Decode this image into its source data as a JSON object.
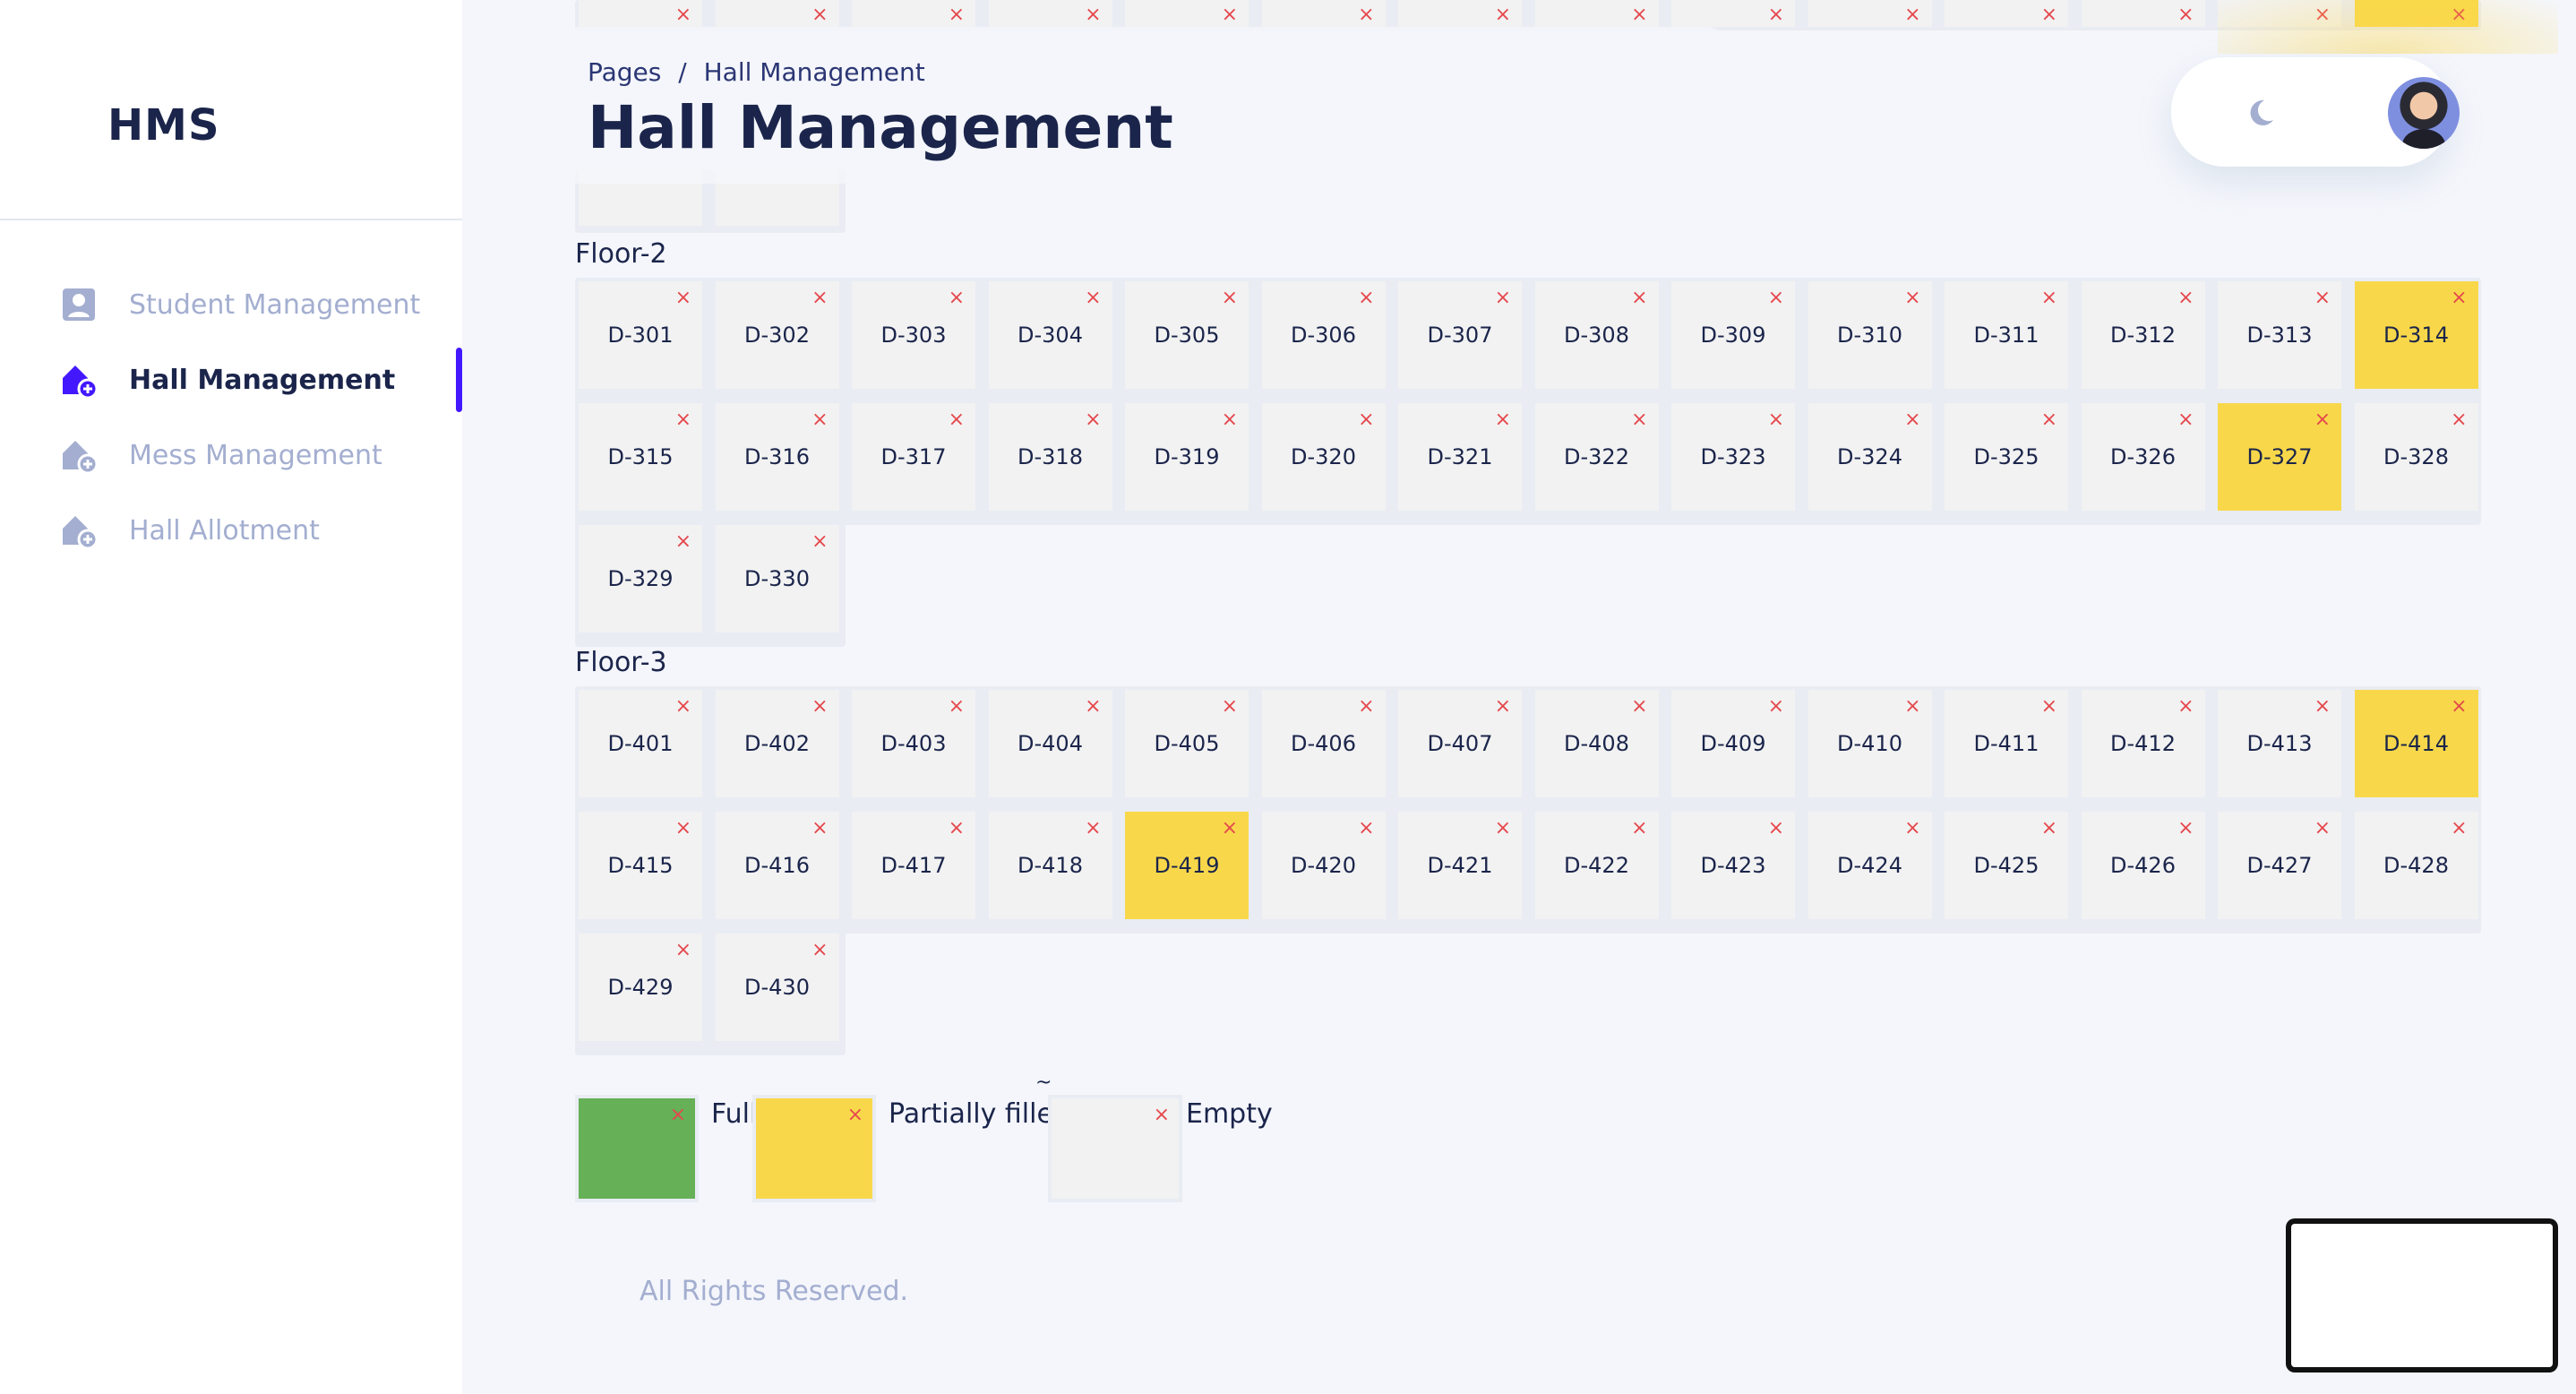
{
  "sidebar": {
    "logo": "HMS",
    "items": [
      {
        "label": "Student Management",
        "icon": "user-square-icon",
        "active": false
      },
      {
        "label": "Hall Management",
        "icon": "home-add-icon",
        "active": true
      },
      {
        "label": "Mess Management",
        "icon": "home-add-icon",
        "active": false
      },
      {
        "label": "Hall Allotment",
        "icon": "home-add-icon",
        "active": false
      }
    ]
  },
  "header": {
    "breadcrumb_root": "Pages",
    "breadcrumb_sep": "/",
    "breadcrumb_current": "Hall Management",
    "title": "Hall Management"
  },
  "floors": [
    {
      "label": "Floor-2",
      "rooms": [
        {
          "id": "D-301",
          "status": "empty"
        },
        {
          "id": "D-302",
          "status": "empty"
        },
        {
          "id": "D-303",
          "status": "empty"
        },
        {
          "id": "D-304",
          "status": "empty"
        },
        {
          "id": "D-305",
          "status": "empty"
        },
        {
          "id": "D-306",
          "status": "empty"
        },
        {
          "id": "D-307",
          "status": "empty"
        },
        {
          "id": "D-308",
          "status": "empty"
        },
        {
          "id": "D-309",
          "status": "empty"
        },
        {
          "id": "D-310",
          "status": "empty"
        },
        {
          "id": "D-311",
          "status": "empty"
        },
        {
          "id": "D-312",
          "status": "empty"
        },
        {
          "id": "D-313",
          "status": "empty"
        },
        {
          "id": "D-314",
          "status": "partial"
        },
        {
          "id": "D-315",
          "status": "empty"
        },
        {
          "id": "D-316",
          "status": "empty"
        },
        {
          "id": "D-317",
          "status": "empty"
        },
        {
          "id": "D-318",
          "status": "empty"
        },
        {
          "id": "D-319",
          "status": "empty"
        },
        {
          "id": "D-320",
          "status": "empty"
        },
        {
          "id": "D-321",
          "status": "empty"
        },
        {
          "id": "D-322",
          "status": "empty"
        },
        {
          "id": "D-323",
          "status": "empty"
        },
        {
          "id": "D-324",
          "status": "empty"
        },
        {
          "id": "D-325",
          "status": "empty"
        },
        {
          "id": "D-326",
          "status": "empty"
        },
        {
          "id": "D-327",
          "status": "partial"
        },
        {
          "id": "D-328",
          "status": "empty"
        },
        {
          "id": "D-329",
          "status": "empty"
        },
        {
          "id": "D-330",
          "status": "empty"
        }
      ]
    },
    {
      "label": "Floor-3",
      "rooms": [
        {
          "id": "D-401",
          "status": "empty"
        },
        {
          "id": "D-402",
          "status": "empty"
        },
        {
          "id": "D-403",
          "status": "empty"
        },
        {
          "id": "D-404",
          "status": "empty"
        },
        {
          "id": "D-405",
          "status": "empty"
        },
        {
          "id": "D-406",
          "status": "empty"
        },
        {
          "id": "D-407",
          "status": "empty"
        },
        {
          "id": "D-408",
          "status": "empty"
        },
        {
          "id": "D-409",
          "status": "empty"
        },
        {
          "id": "D-410",
          "status": "empty"
        },
        {
          "id": "D-411",
          "status": "empty"
        },
        {
          "id": "D-412",
          "status": "empty"
        },
        {
          "id": "D-413",
          "status": "empty"
        },
        {
          "id": "D-414",
          "status": "partial"
        },
        {
          "id": "D-415",
          "status": "empty"
        },
        {
          "id": "D-416",
          "status": "empty"
        },
        {
          "id": "D-417",
          "status": "empty"
        },
        {
          "id": "D-418",
          "status": "empty"
        },
        {
          "id": "D-419",
          "status": "partial"
        },
        {
          "id": "D-420",
          "status": "empty"
        },
        {
          "id": "D-421",
          "status": "empty"
        },
        {
          "id": "D-422",
          "status": "empty"
        },
        {
          "id": "D-423",
          "status": "empty"
        },
        {
          "id": "D-424",
          "status": "empty"
        },
        {
          "id": "D-425",
          "status": "empty"
        },
        {
          "id": "D-426",
          "status": "empty"
        },
        {
          "id": "D-427",
          "status": "empty"
        },
        {
          "id": "D-428",
          "status": "empty"
        },
        {
          "id": "D-429",
          "status": "empty"
        },
        {
          "id": "D-430",
          "status": "empty"
        }
      ]
    }
  ],
  "top_partial_row_highlight": "partial",
  "legend": {
    "marker": "~",
    "items": [
      {
        "label": "Full",
        "status": "full"
      },
      {
        "label": "Partially filled",
        "status": "partial"
      },
      {
        "label": "Empty",
        "status": "empty"
      }
    ]
  },
  "footer": {
    "text": "All Rights Reserved."
  },
  "colors": {
    "accent": "#4318ff",
    "full": "#66b058",
    "partial": "#f8d84a",
    "empty": "#f2f2f2",
    "close_x": "#e5484d",
    "muted_text": "#a3aed0"
  },
  "close_glyph": "×"
}
